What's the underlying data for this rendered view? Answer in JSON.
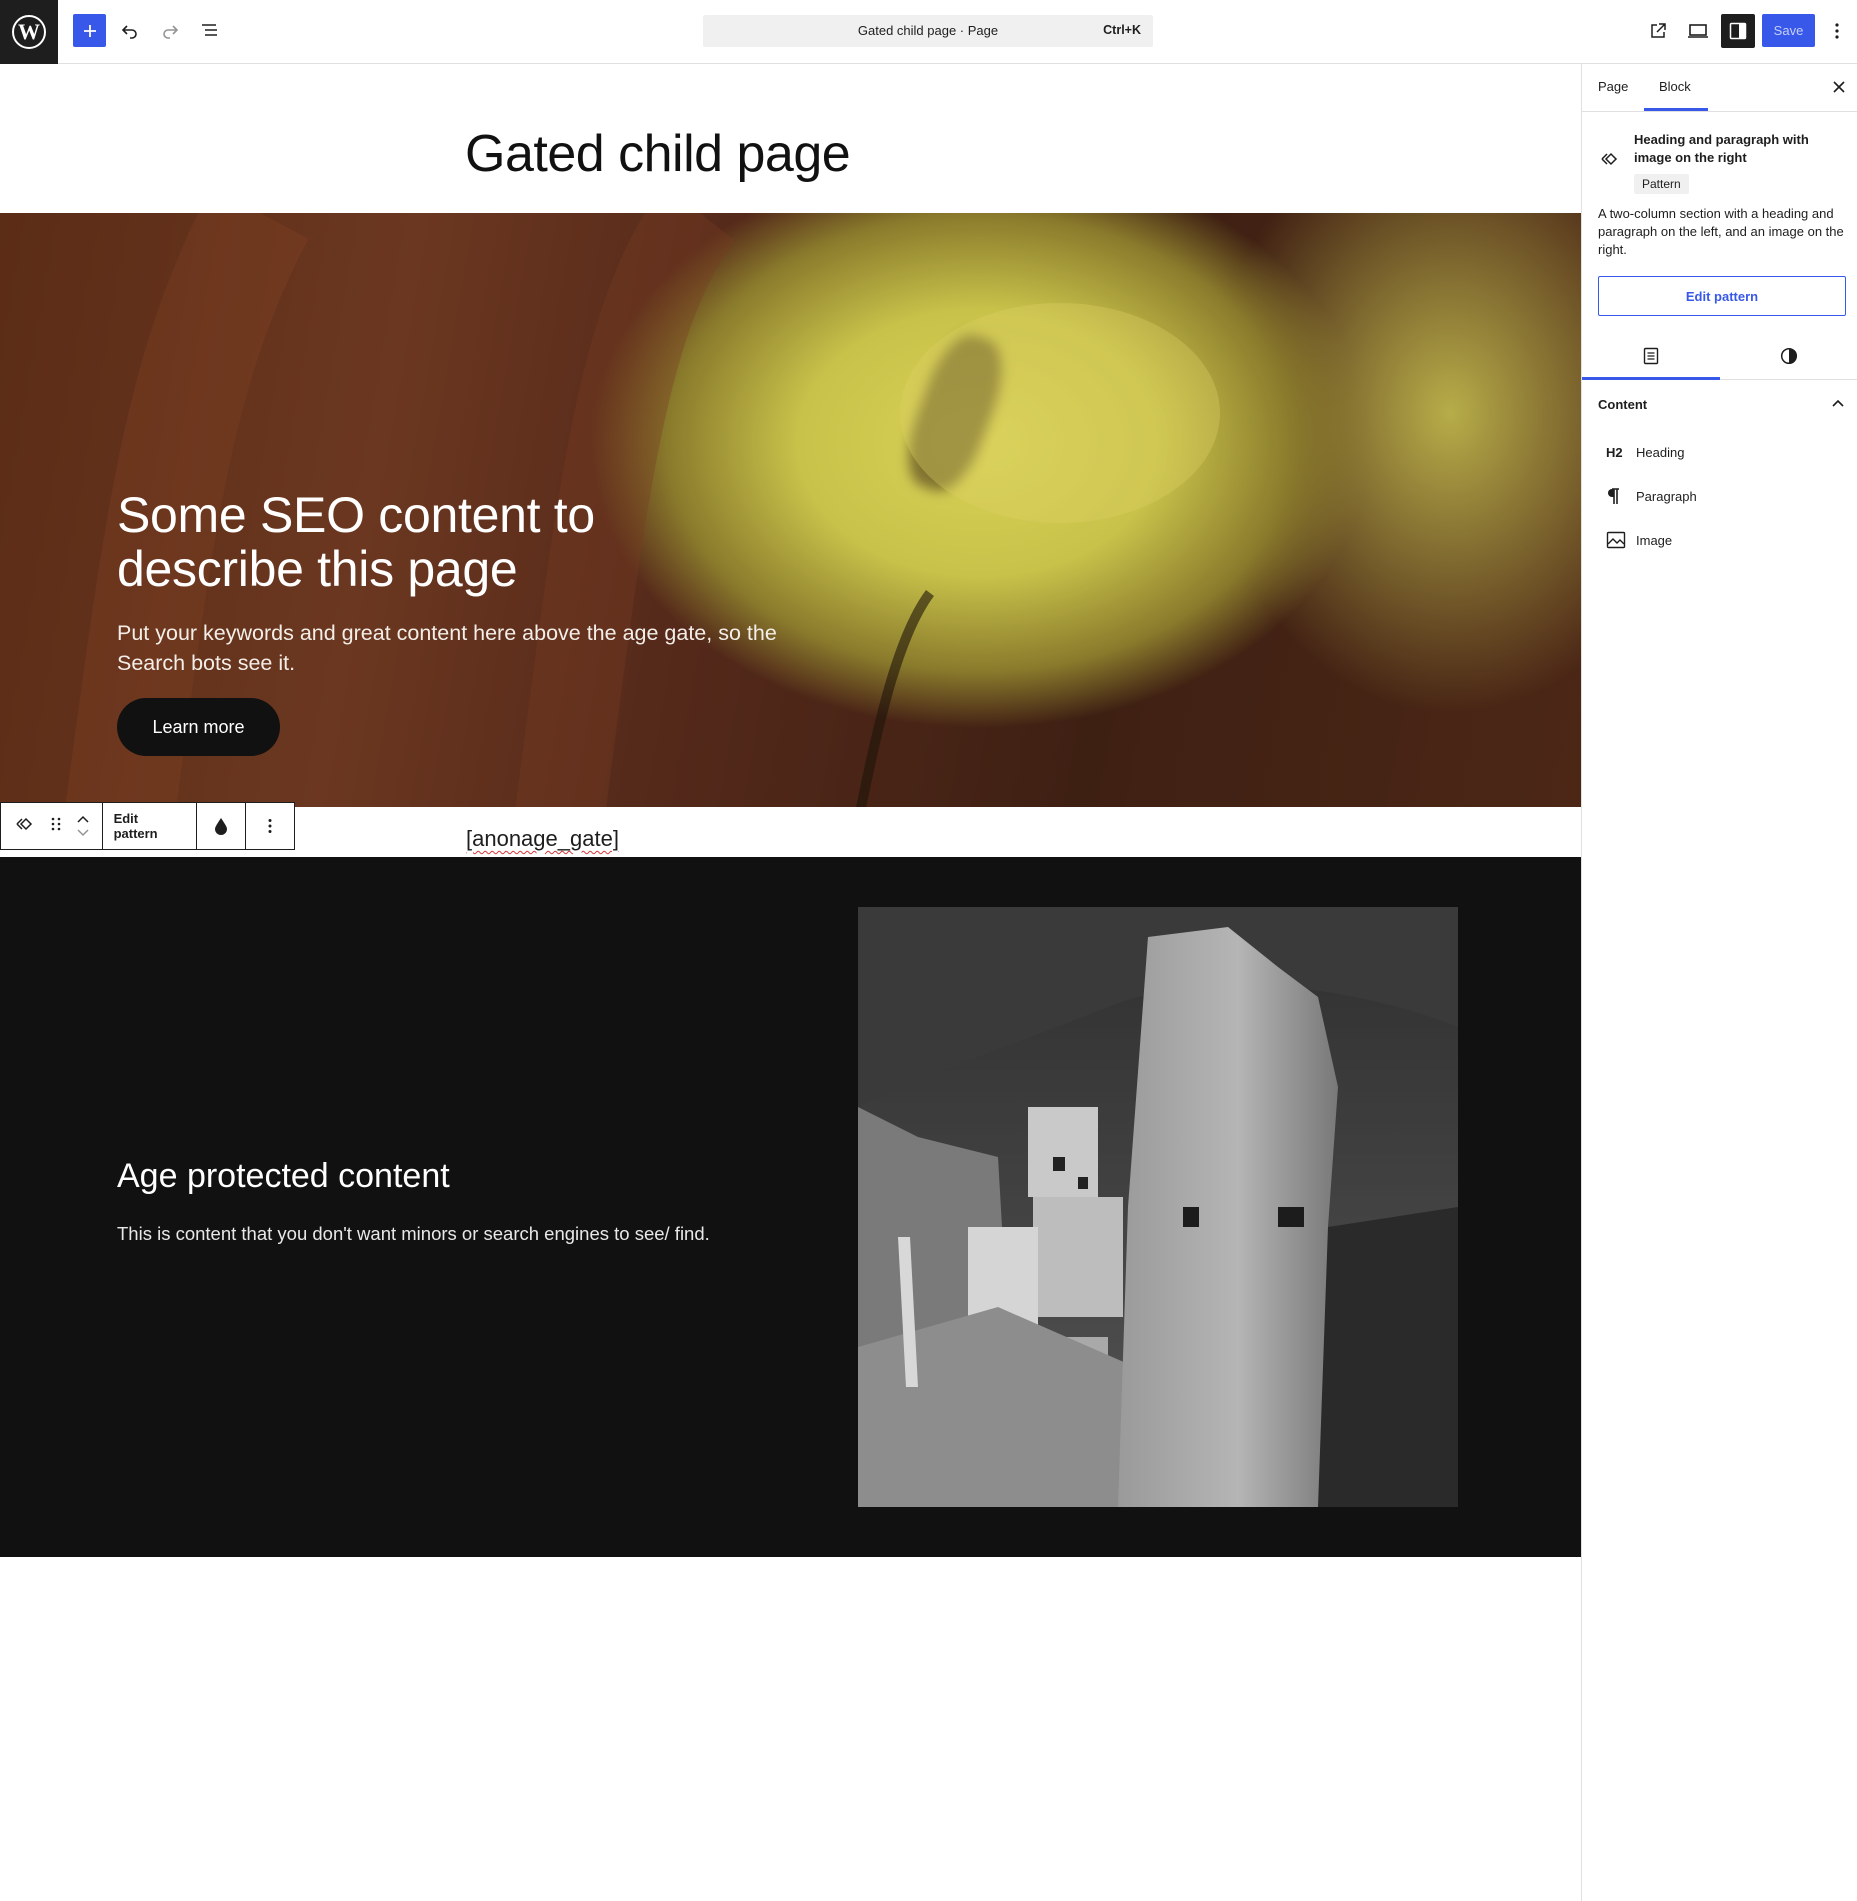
{
  "toolbar": {
    "document_title": "Gated child page · Page",
    "shortcut": "Ctrl+K",
    "save_label": "Save"
  },
  "canvas": {
    "page_title": "Gated child page",
    "hero": {
      "heading": "Some SEO content to describe this page",
      "paragraph": "Put your keywords and great content here above the age gate, so the Search bots see it.",
      "button_label": "Learn more"
    },
    "block_toolbar": {
      "edit_pattern_label": "Edit pattern"
    },
    "shortcode": "[anonage_gate]",
    "protected": {
      "heading": "Age protected content",
      "paragraph": "This is content that you don't want minors or search engines to see/ find."
    }
  },
  "sidebar": {
    "tabs": [
      {
        "label": "Page"
      },
      {
        "label": "Block"
      }
    ],
    "block": {
      "title": "Heading and paragraph with image on the right",
      "badge": "Pattern",
      "description": "A two-column section with a heading and paragraph on the left, and an image on the right.",
      "edit_button": "Edit pattern"
    },
    "content_section": {
      "label": "Content",
      "items": [
        {
          "icon": "H2",
          "label": "Heading"
        },
        {
          "icon": "paragraph-icon",
          "label": "Paragraph"
        },
        {
          "icon": "image-icon",
          "label": "Image"
        }
      ]
    }
  },
  "colors": {
    "accent": "#3858e9",
    "dark_bg": "#111112",
    "error_underline": "#d63638"
  }
}
